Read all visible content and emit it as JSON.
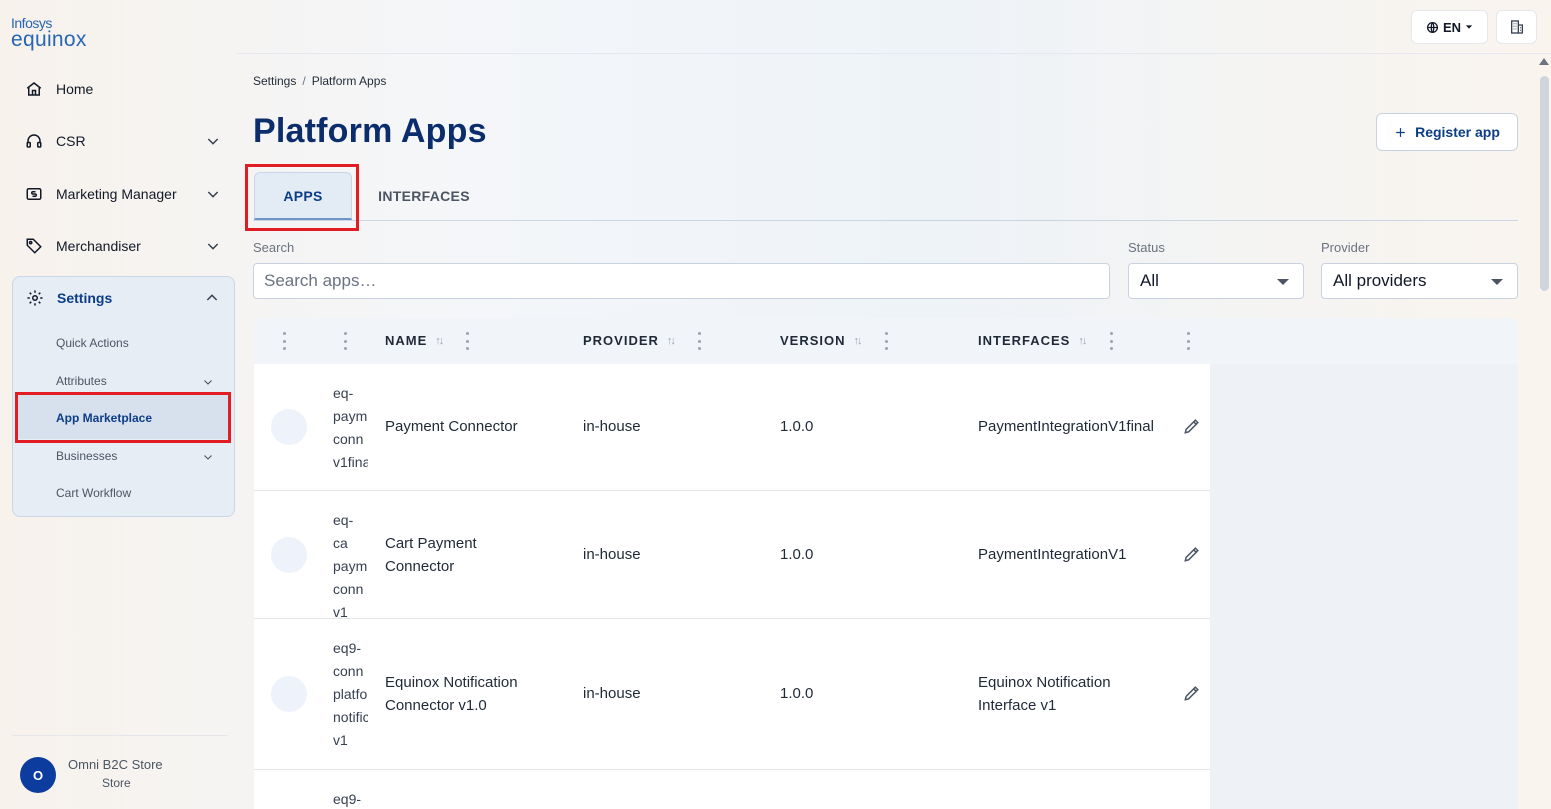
{
  "logo": {
    "line1": "Infosys",
    "line2": "equinox"
  },
  "sidebar": {
    "items": [
      {
        "label": "Home"
      },
      {
        "label": "CSR"
      },
      {
        "label": "Marketing Manager"
      },
      {
        "label": "Merchandiser"
      }
    ],
    "settings": {
      "label": "Settings",
      "subitems": [
        {
          "label": "Quick Actions"
        },
        {
          "label": "Attributes"
        },
        {
          "label": "App Marketplace"
        },
        {
          "label": "Businesses"
        },
        {
          "label": "Cart Workflow"
        }
      ]
    },
    "user": {
      "initial": "O",
      "name": "Omni B2C Store",
      "role": "Store"
    }
  },
  "topbar": {
    "language": "EN"
  },
  "breadcrumb": {
    "parent": "Settings",
    "separator": "/",
    "current": "Platform Apps"
  },
  "page": {
    "title": "Platform Apps",
    "register_label": "Register app"
  },
  "tabs": [
    {
      "label": "APPS"
    },
    {
      "label": "INTERFACES"
    }
  ],
  "filters": {
    "search_label": "Search",
    "search_placeholder": "Search apps…",
    "status_label": "Status",
    "status_value": "All",
    "provider_label": "Provider",
    "provider_value": "All providers"
  },
  "table": {
    "columns": {
      "name": "NAME",
      "provider": "PROVIDER",
      "version": "VERSION",
      "interfaces": "INTERFACES"
    },
    "rows": [
      {
        "id": "eq-\npaym\nconn\nv1fina",
        "name": "Payment Connector",
        "provider": "in-house",
        "version": "1.0.0",
        "interfaces": "PaymentIntegrationV1final"
      },
      {
        "id": "eq-ca\npaym\nconn\nv1",
        "name": "Cart Payment Connector",
        "provider": "in-house",
        "version": "1.0.0",
        "interfaces": "PaymentIntegrationV1"
      },
      {
        "id": "eq9-\nconn\nplatfo\nnotific\nv1",
        "name": "Equinox Notification Connector v1.0",
        "provider": "in-house",
        "version": "1.0.0",
        "interfaces": "Equinox Notification Interface v1"
      },
      {
        "id": "eq9-",
        "name": "",
        "provider": "",
        "version": "",
        "interfaces": ""
      }
    ]
  }
}
